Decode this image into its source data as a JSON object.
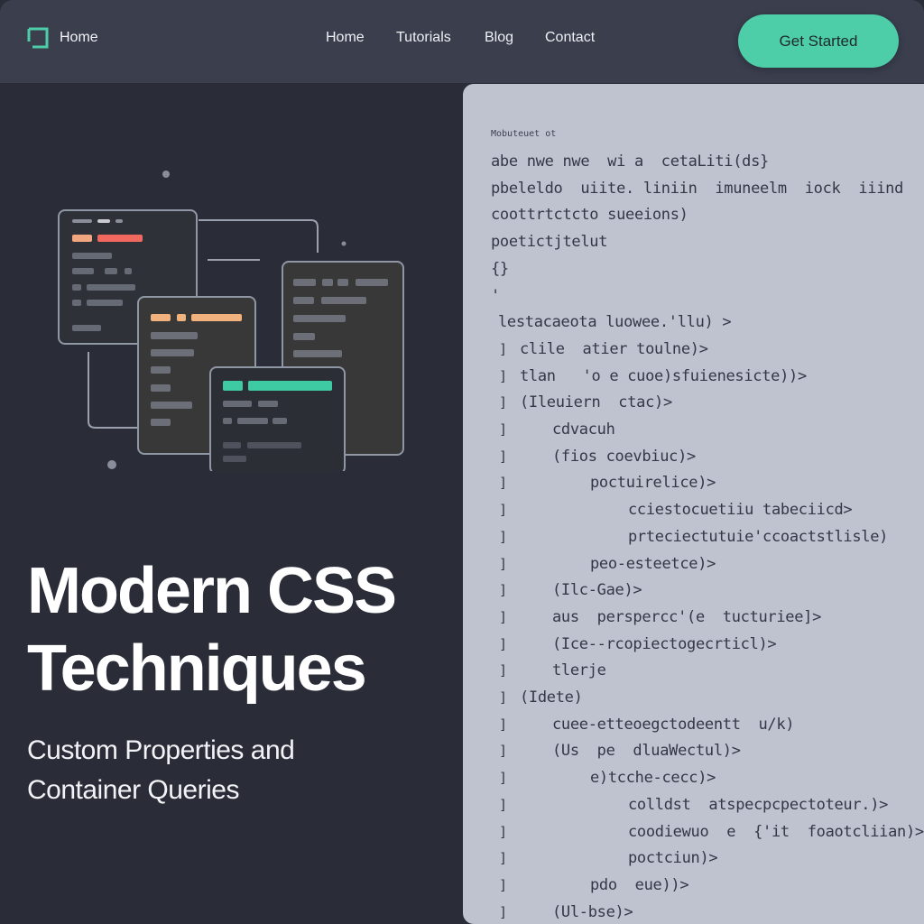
{
  "nav": {
    "brand_label": "Home",
    "links": [
      "Home",
      "Tutorials",
      "Blog",
      "Contact"
    ],
    "cta_label": "Get Started"
  },
  "hero": {
    "title_line1": "Modern CSS",
    "title_line2": "Techniques",
    "subtitle_line1": "Custom Properties and",
    "subtitle_line2": "Container Queries"
  },
  "code": {
    "caption": "Mobuteuet ot",
    "lines": [
      "abe nwe nwe  wi a  cetaLiti(ds}",
      "pbeleldo  uiite. liniin  imuneelm  iock  iiind",
      "coottrtctcto sueeions)",
      "poetictjtelut",
      "{}",
      "'",
      "lestacaeota luowee.'llu) >",
      "clile  atier toulne)>",
      "tlan   'o e cuoe)sfuienesicte))>",
      "(Ileuiern  ctac)>",
      "cdvacuh",
      "(fios coevbiuc)>",
      "poctuirelice)>",
      "cciestocuetiiu tabeciicd>",
      "prteciectutuie'ccoactstlisle)",
      "peo-esteetce)>",
      "(Ilc-Gae)>",
      "aus  perspercc'(e  tucturiee]>",
      "(Ice--rcopiectogecrticl)>",
      "tlerje",
      "(Idete)",
      "cuee-etteoegctodeentt  u/k)",
      "(Us  pe  dluaWectul)>",
      "e)tcche-cecc)>",
      "colldst  atspecpcpectoteur.)>",
      "coodiewuo  e  {'it  foaotcliian)>",
      "poctciun)>",
      "pdo  eue))>",
      "(Ul-bse)>"
    ]
  },
  "colors": {
    "accent": "#4ecda9",
    "nav_bg": "#3a3e4d",
    "left_bg": "#2a2d38",
    "code_bg": "#bfc3d0",
    "salmon": "#f08a6e",
    "peach": "#f2b27e",
    "mint": "#3ecba3"
  },
  "icons": [
    "logo-icon",
    "window-stack-illustration"
  ]
}
